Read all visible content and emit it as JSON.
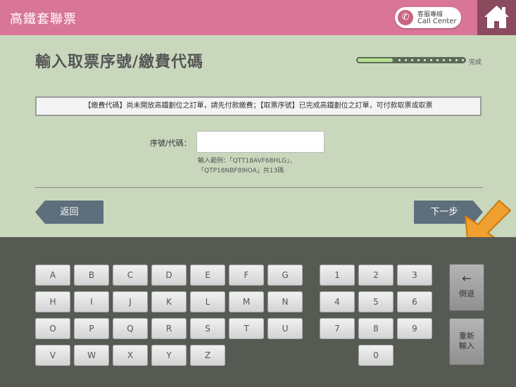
{
  "header": {
    "title": "高鐵套聯票",
    "call_center_line1": "客服專線",
    "call_center_line2": "Call Center"
  },
  "main": {
    "page_title": "輸入取票序號/繳費代碼",
    "progress_label": "完成",
    "progress_fraction": 0.33,
    "info_text": "【繳費代碼】尚未開放高鐵劃位之訂單，請先付款繳費；【取票序號】已完成高鐵劃位之訂單，可付款取票或取票",
    "field_label": "序號/代碼：",
    "field_value": "",
    "field_placeholder": "",
    "hint_line1": "輸入範例：「QTT18AVF68HLG」、",
    "hint_line2": "「QTP18NBF89IOA」共13碼",
    "back_label": "返回",
    "next_label": "下一步"
  },
  "keyboard": {
    "letter_rows": [
      [
        "A",
        "B",
        "C",
        "D",
        "E",
        "F",
        "G"
      ],
      [
        "H",
        "I",
        "J",
        "K",
        "L",
        "M",
        "N"
      ],
      [
        "O",
        "P",
        "Q",
        "R",
        "S",
        "T",
        "U"
      ],
      [
        "V",
        "W",
        "X",
        "Y",
        "Z"
      ]
    ],
    "digit_rows": [
      [
        "1",
        "2",
        "3"
      ],
      [
        "4",
        "5",
        "6"
      ],
      [
        "7",
        "8",
        "9"
      ],
      [
        "0"
      ]
    ],
    "backspace_arrow": "←",
    "backspace_label": "倒退",
    "reset_label_line1": "重新",
    "reset_label_line2": "輸入"
  },
  "colors": {
    "header": "#d97596",
    "home": "#8b4a5e",
    "background": "#c9d8bd",
    "keyboard": "#555a52",
    "button": "#5d6e7c",
    "arrow": "#f0a030"
  },
  "icons": {
    "call": "phone-icon",
    "home": "home-icon",
    "pointer": "pointer-arrow-icon"
  }
}
